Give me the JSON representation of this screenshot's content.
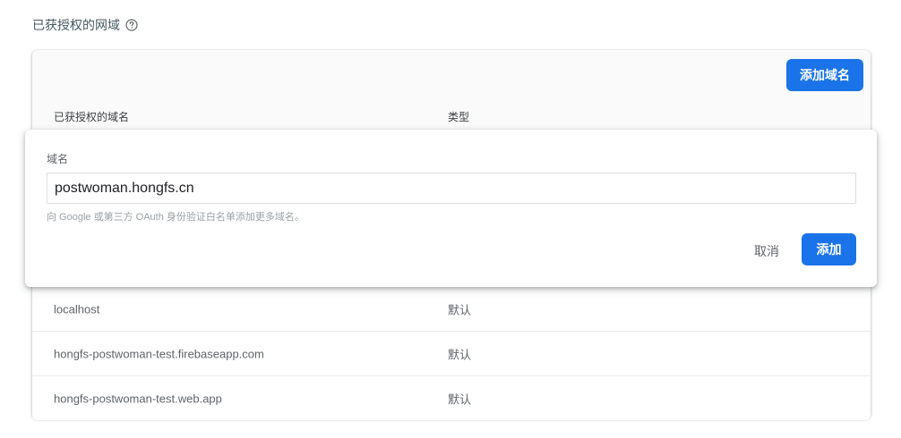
{
  "section": {
    "title": "已获授权的网域",
    "help_icon": "help-circle-icon"
  },
  "card": {
    "add_domain_label": "添加域名",
    "columns": {
      "domain": "已获授权的域名",
      "type": "类型"
    },
    "rows": [
      {
        "domain": "localhost",
        "type": "默认"
      },
      {
        "domain": "hongfs-postwoman-test.firebaseapp.com",
        "type": "默认"
      },
      {
        "domain": "hongfs-postwoman-test.web.app",
        "type": "默认"
      }
    ]
  },
  "dialog": {
    "field_label": "域名",
    "field_value": "postwoman.hongfs.cn",
    "hint": "向 Google 或第三方 OAuth 身份验证白名单添加更多域名。",
    "cancel_label": "取消",
    "confirm_label": "添加"
  },
  "colors": {
    "primary": "#1a73e8"
  }
}
